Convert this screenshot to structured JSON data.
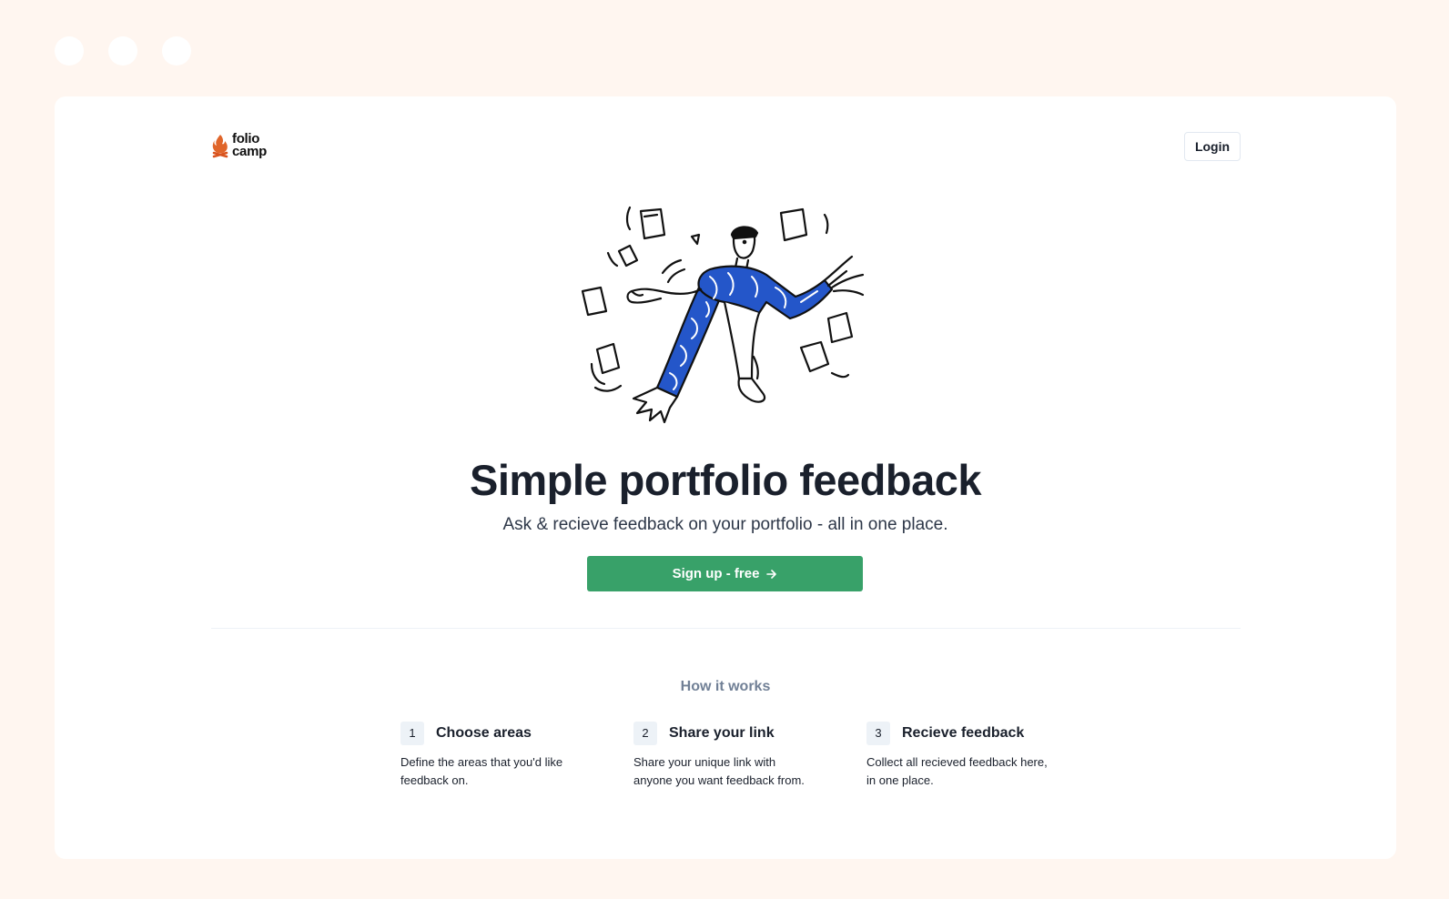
{
  "window": {
    "dots": [
      "window-dot-1",
      "window-dot-2",
      "window-dot-3"
    ]
  },
  "header": {
    "logo_line1": "folio",
    "logo_line2": "camp",
    "login_label": "Login"
  },
  "hero": {
    "title": "Simple portfolio feedback",
    "subtitle": "Ask & recieve feedback on your portfolio - all in one place.",
    "cta_label": "Sign up - free",
    "cta_icon": "arrow-right-icon"
  },
  "how": {
    "title": "How it works",
    "steps": [
      {
        "number": "1",
        "title": "Choose areas",
        "description": "Define the areas that you'd like feedback on."
      },
      {
        "number": "2",
        "title": "Share your link",
        "description": "Share your unique link with anyone you want feedback from."
      },
      {
        "number": "3",
        "title": "Recieve feedback",
        "description": "Collect all recieved feedback here, in one place."
      }
    ]
  },
  "colors": {
    "page_bg": "#fff6f0",
    "card_bg": "#ffffff",
    "cta_green": "#38a169",
    "illustration_blue": "#2456c9",
    "logo_flame": "#e0652a"
  }
}
